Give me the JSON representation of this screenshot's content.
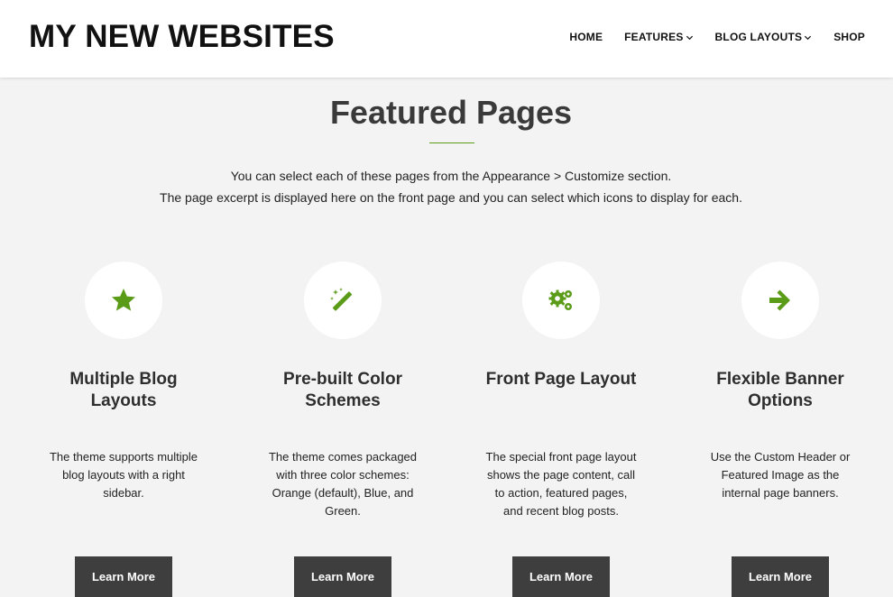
{
  "header": {
    "logo": "MY NEW WEBSITES",
    "nav": [
      {
        "label": "HOME",
        "has_dropdown": false
      },
      {
        "label": "FEATURES",
        "has_dropdown": true
      },
      {
        "label": "BLOG LAYOUTS",
        "has_dropdown": true
      },
      {
        "label": "SHOP",
        "has_dropdown": false
      }
    ]
  },
  "section": {
    "title": "Featured Pages",
    "intro_line1": "You can select each of these pages from the Appearance > Customize section.",
    "intro_line2": "The page excerpt is displayed here on the front page and you can select which icons to display for each."
  },
  "cards": [
    {
      "icon": "star-icon",
      "title_line1": "Multiple Blog",
      "title_line2": "Layouts",
      "text_line1": "The theme supports multiple",
      "text_line2": "blog layouts with a right",
      "text_line3": "sidebar.",
      "text_line4": "",
      "button": "Learn More"
    },
    {
      "icon": "magic-wand-icon",
      "title_line1": "Pre-built Color",
      "title_line2": "Schemes",
      "text_line1": "The theme comes packaged",
      "text_line2": "with three color schemes:",
      "text_line3": "Orange (default), Blue, and",
      "text_line4": "Green.",
      "button": "Learn More"
    },
    {
      "icon": "gears-icon",
      "title_line1": "Front Page Layout",
      "title_line2": "",
      "text_line1": "The special front page layout",
      "text_line2": "shows the page content, call",
      "text_line3": "to action, featured pages,",
      "text_line4": "and recent blog posts.",
      "button": "Learn More"
    },
    {
      "icon": "arrow-right-icon",
      "title_line1": "Flexible Banner",
      "title_line2": "Options",
      "text_line1": "Use the Custom Header or",
      "text_line2": "Featured Image as the",
      "text_line3": "internal page banners.",
      "text_line4": "",
      "button": "Learn More"
    }
  ],
  "colors": {
    "accent": "#5a9b18",
    "button_bg": "#3e3e3e",
    "page_bg": "#f3f3f3"
  }
}
